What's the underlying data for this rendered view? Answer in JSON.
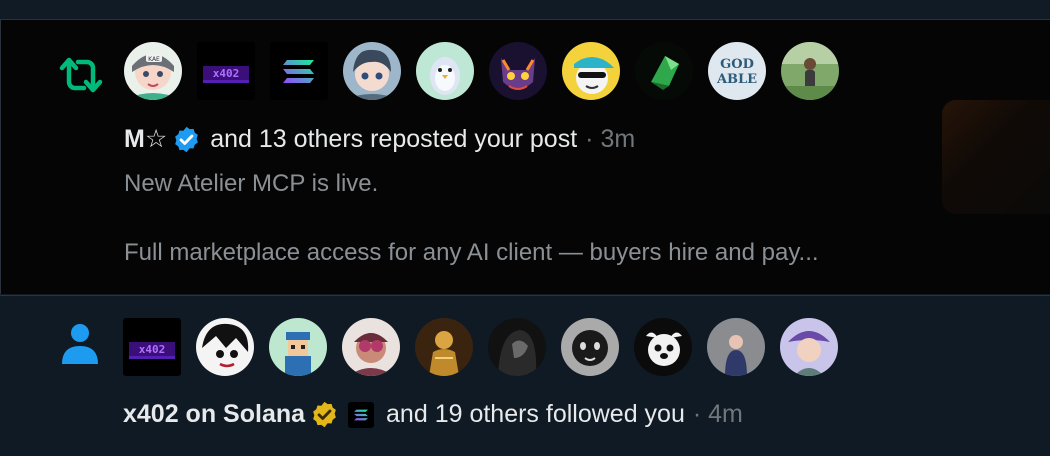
{
  "colors": {
    "retweet_green": "#00ba7c",
    "follow_blue": "#1d9bf0",
    "verified_blue": "#1d9bf0",
    "verified_gold": "#e2b719",
    "muted_text": "#71767b"
  },
  "notifications": [
    {
      "type_icon": "repost-icon",
      "avatars": [
        "anime-girl-avatar",
        "x402-logo-avatar",
        "solana-logo-avatar",
        "anime-boy-avatar",
        "penguin-avatar",
        "cat-avatar",
        "cap-character-avatar",
        "green-crystal-avatar",
        "god-is-able-avatar",
        "person-field-avatar"
      ],
      "actor_name": "M☆",
      "actor_badge": "blue-verified-badge",
      "action_text": "and 13 others reposted your post",
      "time": "· 3m",
      "snippet_line1": "New Atelier MCP is live.",
      "snippet_line2": "Full marketplace access for any AI client — buyers hire and pay..."
    },
    {
      "type_icon": "person-icon",
      "avatars": [
        "x402-logo-avatar",
        "manga-avatar",
        "pixel-boy-avatar",
        "goggles-avatar",
        "gold-figure-avatar",
        "dark-hood-avatar",
        "masked-avatar",
        "cartoon-dog-avatar",
        "figure-avatar",
        "woman-hat-avatar"
      ],
      "actor_name": "x402 on Solana",
      "actor_badge": "gold-verified-badge",
      "action_text": "and 19 others followed you",
      "time": "· 4m"
    }
  ]
}
